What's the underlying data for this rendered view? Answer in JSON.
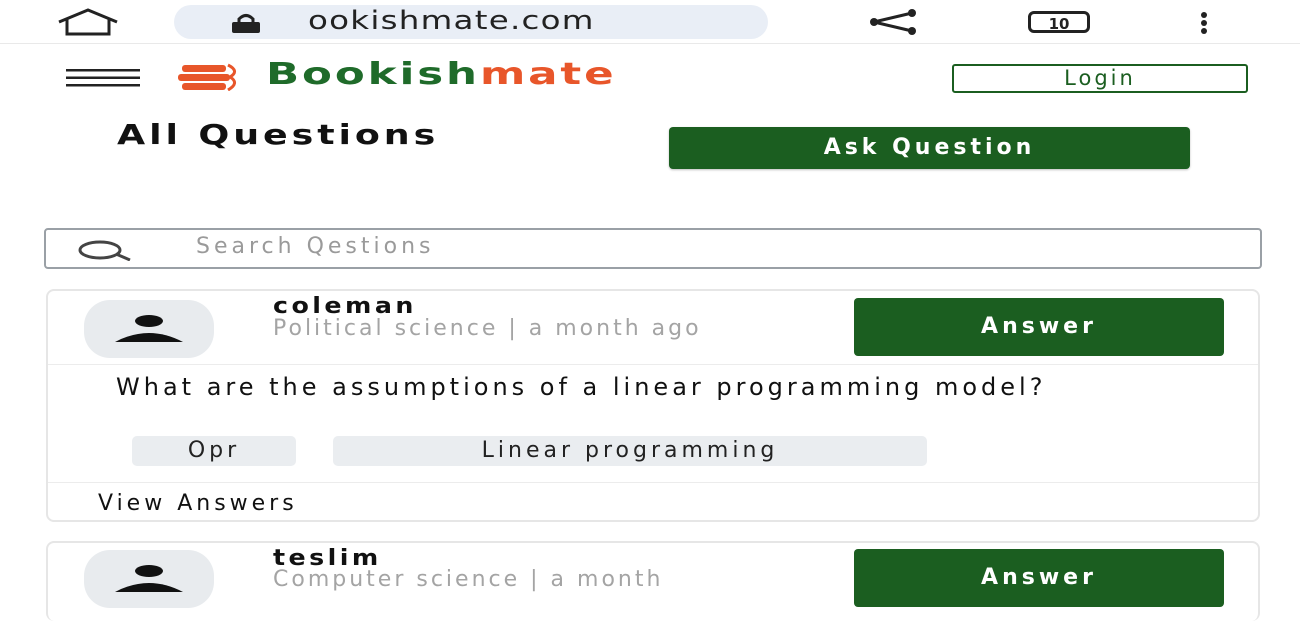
{
  "browser": {
    "url": "ookishmate.com",
    "tab_count": "10"
  },
  "header": {
    "brand_part1": "Bookish",
    "brand_part2": "mate",
    "login_label": "Login",
    "colors": {
      "primary": "#1b5e20",
      "accent": "#e8562a"
    }
  },
  "page": {
    "title": "All Questions",
    "ask_label": "Ask Question",
    "search_placeholder": "Search Qestions"
  },
  "questions": [
    {
      "author": "coleman",
      "meta": "Political science  | a month ago",
      "answer_label": "Answer",
      "text": "What are the assumptions of a linear programming model?",
      "tags": [
        "Opr",
        "Linear programming"
      ],
      "view_label": "View Answers"
    },
    {
      "author": "teslim",
      "meta": "Computer science | a month",
      "answer_label": "Answer"
    }
  ],
  "icons": [
    "home-icon",
    "lock-icon",
    "share-icon",
    "tabs-icon",
    "menu-dots-icon",
    "hamburger-icon",
    "logo-icon",
    "search-icon",
    "user-icon"
  ]
}
